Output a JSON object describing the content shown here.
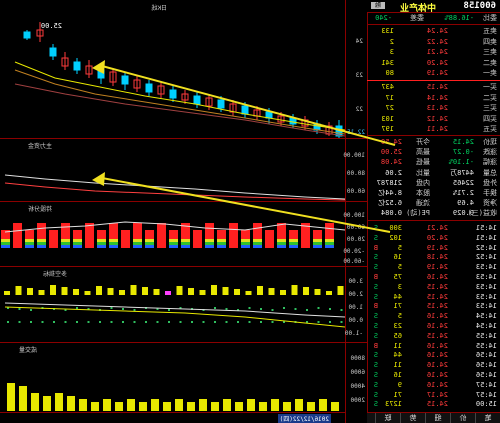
{
  "stock": {
    "code": "600158",
    "name": "中体产业",
    "badge": "融"
  },
  "header_row": {
    "label": "委比",
    "value": "-16.88%",
    "label2": "委差",
    "value2": "-240"
  },
  "sell_orders": [
    {
      "label": "卖五",
      "price": "24.24",
      "vol": "133"
    },
    {
      "label": "卖四",
      "price": "24.22",
      "vol": "2"
    },
    {
      "label": "卖三",
      "price": "24.21",
      "vol": "3"
    },
    {
      "label": "卖二",
      "price": "24.20",
      "vol": "341"
    },
    {
      "label": "卖一",
      "price": "24.19",
      "vol": "80"
    }
  ],
  "buy_orders": [
    {
      "label": "买一",
      "price": "24.15",
      "vol": "437"
    },
    {
      "label": "买二",
      "price": "24.14",
      "vol": "17"
    },
    {
      "label": "买三",
      "price": "24.13",
      "vol": "27"
    },
    {
      "label": "买四",
      "price": "24.12",
      "vol": "103"
    },
    {
      "label": "买五",
      "price": "24.11",
      "vol": "197"
    }
  ],
  "stats": [
    {
      "l1": "现价",
      "v1": "24.15",
      "l2": "今开",
      "v2": "24.50"
    },
    {
      "l1": "涨跌",
      "v1": "-0.27",
      "l2": "最高",
      "v2": "25.00"
    },
    {
      "l1": "涨幅",
      "v1": "-1.10%",
      "l2": "最低",
      "v2": "24.08"
    },
    {
      "l1": "总量",
      "v1": "4478万",
      "l2": "量比",
      "v2": "2.06"
    },
    {
      "l1": "外盘",
      "v1": "22465",
      "l2": "内盘",
      "v2": "218787"
    },
    {
      "l1": "换手",
      "v1": "2.71%",
      "l2": "股本",
      "v2": "8.44亿"
    },
    {
      "l1": "净资",
      "v1": "4.69",
      "l2": "流通",
      "v2": "6.52亿"
    },
    {
      "l1": "收益(三)",
      "v1": "0.029",
      "l2": "PE(动)",
      "v2": "0.084"
    }
  ],
  "ticks": [
    {
      "time": "14:51",
      "price": "24.21",
      "vol": "300",
      "dir": "S"
    },
    {
      "time": "14:51",
      "price": "24.20",
      "vol": "102",
      "dir": "S"
    },
    {
      "time": "14:52",
      "price": "24.19",
      "vol": "5",
      "dir": "B"
    },
    {
      "time": "14:52",
      "price": "24.18",
      "vol": "16",
      "dir": "S"
    },
    {
      "time": "14:53",
      "price": "24.19",
      "vol": "5",
      "dir": "S"
    },
    {
      "time": "14:53",
      "price": "24.16",
      "vol": "75",
      "dir": "B"
    },
    {
      "time": "14:53",
      "price": "24.15",
      "vol": "3",
      "dir": "S"
    },
    {
      "time": "14:53",
      "price": "24.15",
      "vol": "44",
      "dir": "S"
    },
    {
      "time": "14:53",
      "price": "24.15",
      "vol": "71",
      "dir": "B"
    },
    {
      "time": "14:54",
      "price": "24.16",
      "vol": "5",
      "dir": "S"
    },
    {
      "time": "14:54",
      "price": "24.16",
      "vol": "23",
      "dir": "S"
    },
    {
      "time": "14:55",
      "price": "24.15",
      "vol": "65",
      "dir": "S"
    },
    {
      "time": "14:55",
      "price": "24.16",
      "vol": "11",
      "dir": "B"
    },
    {
      "time": "14:56",
      "price": "24.16",
      "vol": "44",
      "dir": "S"
    },
    {
      "time": "14:56",
      "price": "24.16",
      "vol": "11",
      "dir": "S"
    },
    {
      "time": "14:56",
      "price": "24.16",
      "vol": "16",
      "dir": "S"
    },
    {
      "time": "14:57",
      "price": "24.16",
      "vol": "9",
      "dir": "S"
    },
    {
      "time": "14:57",
      "price": "24.17",
      "vol": "71",
      "dir": "S"
    },
    {
      "time": "15:00",
      "price": "24.15",
      "vol": "1273",
      "dir": "S"
    }
  ],
  "tabs": [
    "笔",
    "价",
    "细",
    "势",
    "联"
  ],
  "charts": {
    "price_panel_title": "日K线",
    "price_max_label": "25.00",
    "price_axis": [
      "24",
      "23",
      "22"
    ],
    "price_low_label": "22.15",
    "panel2_title": "主力资金",
    "panel2_axis": [
      "100.00",
      "80.00",
      "60.00"
    ],
    "panel3_title": "持股分析",
    "panel3_axis": [
      "100.00",
      "60.00",
      "20.00",
      "-20.00",
      "-60.00"
    ],
    "panel4_title": "多空指标",
    "panel4_axis": [
      "3.00",
      "2.00",
      "1.00",
      "0.00",
      "-1.00"
    ],
    "panel5_title": "成交量",
    "panel5_axis": [
      "8000",
      "6000",
      "4000",
      "2000"
    ],
    "date_label": "2016/12/22(四)"
  },
  "arrow_color": "#f0e020",
  "colors": {
    "up": "#ff3b3b",
    "down": "#00d0ff",
    "ma_yellow": "#e8e800",
    "border": "#8b0000"
  }
}
